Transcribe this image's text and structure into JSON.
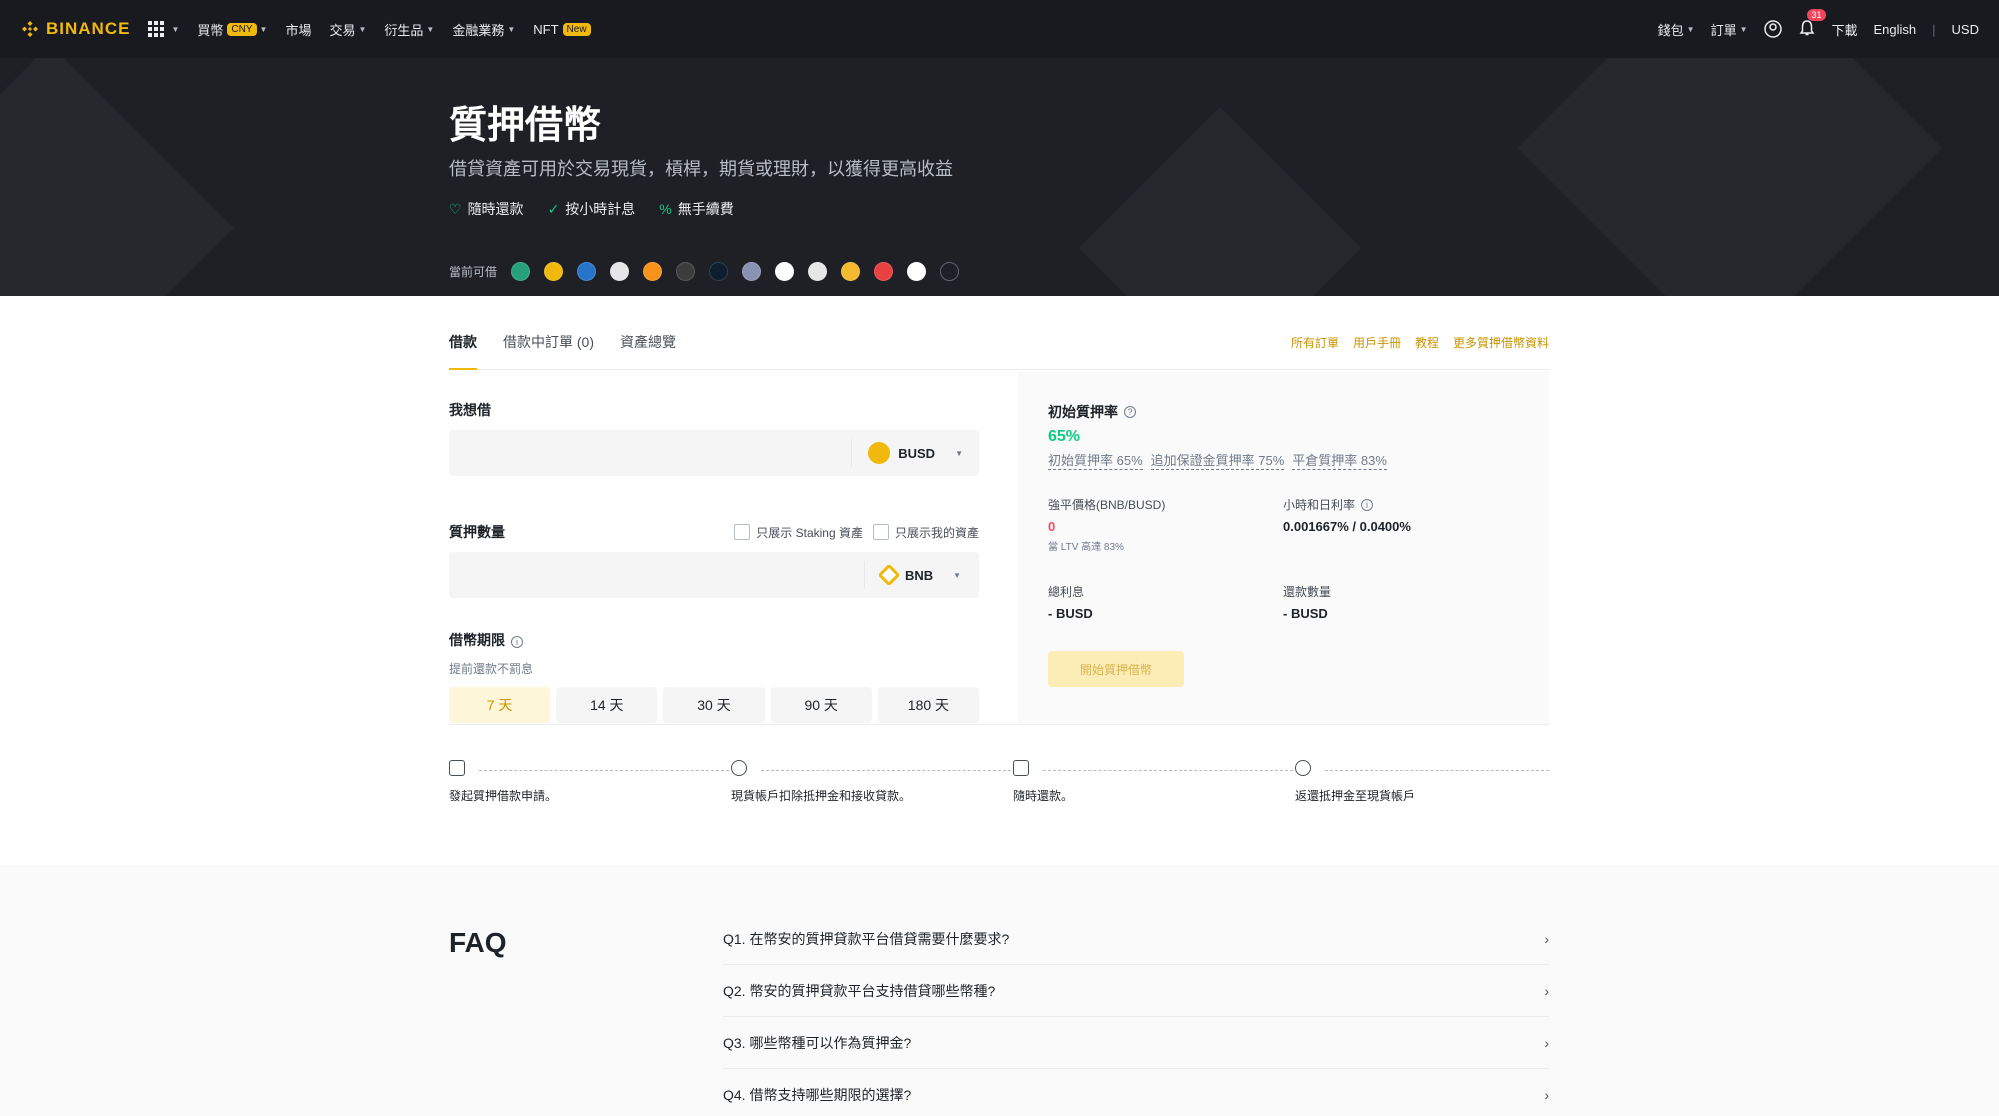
{
  "nav": {
    "brand": "BINANCE",
    "items": [
      {
        "label": "買幣",
        "pill": "CNY",
        "caret": true
      },
      {
        "label": "市場",
        "caret": false
      },
      {
        "label": "交易",
        "caret": true
      },
      {
        "label": "衍生品",
        "caret": true
      },
      {
        "label": "金融業務",
        "caret": true
      },
      {
        "label": "NFT",
        "pill": "New",
        "caret": false
      }
    ],
    "wallet": "錢包",
    "orders": "訂單",
    "notifications": "31",
    "download": "下載",
    "language": "English",
    "currency": "USD"
  },
  "hero": {
    "title": "質押借幣",
    "subtitle": "借貸資產可用於交易現貨，槓桿，期貨或理財，以獲得更高收益",
    "features": [
      "隨時還款",
      "按小時計息",
      "無手續費"
    ],
    "coins_label": "當前可借"
  },
  "tabs": {
    "items": [
      "借款",
      "借款中訂單 (0)",
      "資產總覽"
    ],
    "links": [
      "所有訂單",
      "用戶手冊",
      "教程",
      "更多質押借幣資料"
    ]
  },
  "form": {
    "borrow_label": "我想借",
    "borrow_coin": "BUSD",
    "collateral_label": "質押數量",
    "staking_only": "只展示 Staking 資產",
    "my_assets_only": "只展示我的資產",
    "collateral_coin": "BNB",
    "term_label": "借幣期限",
    "term_note": "提前還款不罰息",
    "terms": [
      "7 天",
      "14 天",
      "30 天",
      "90 天",
      "180 天"
    ]
  },
  "panel": {
    "initial_ltv_label": "初始質押率",
    "initial_ltv_value": "65%",
    "ltv_items": [
      "初始質押率 65%",
      "追加保證金質押率 75%",
      "平倉質押率 83%"
    ],
    "liq_price_label": "強平價格(BNB/BUSD)",
    "liq_price_value": "0",
    "liq_price_note": "當 LTV 高達 83%",
    "rate_label": "小時和日利率",
    "rate_value": "0.001667% / 0.0400%",
    "total_interest_label": "總利息",
    "total_interest_value": "- BUSD",
    "repay_label": "還款數量",
    "repay_value": "- BUSD",
    "start_button": "開始質押借幣"
  },
  "steps": [
    "發起質押借款申請。",
    "現貨帳戶扣除抵押金和接收貸款。",
    "隨時還款。",
    "返還抵押金至現貨帳戶"
  ],
  "faq": {
    "title": "FAQ",
    "items": [
      "Q1. 在幣安的質押貸款平台借貸需要什麼要求?",
      "Q2. 幣安的質押貸款平台支持借貸哪些幣種?",
      "Q3. 哪些幣種可以作為質押金?",
      "Q4. 借幣支持哪些期限的選擇?"
    ]
  },
  "colors": {
    "accent": "#f0b90b",
    "green": "#0ecb81",
    "red": "#f6465d",
    "dark": "#181a20"
  }
}
